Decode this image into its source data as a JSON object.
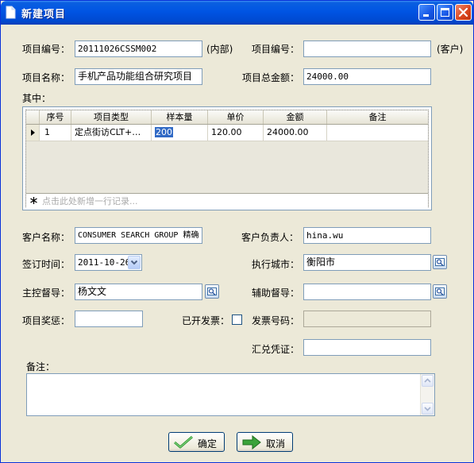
{
  "window": {
    "title": "新建项目"
  },
  "form": {
    "project_no_label": "项目编号：",
    "project_no_value": "20111026CSSM002",
    "internal_suffix": "(内部)",
    "client_project_no_label": "项目编号：",
    "client_project_no_value": "",
    "client_suffix": "(客户)",
    "project_name_label": "项目名称：",
    "project_name_value": "手机产品功能组合研究项目",
    "total_amount_label": "项目总金额：",
    "total_amount_value": "24000.00",
    "of_which_label": "其中：",
    "customer_name_label": "客户名称：",
    "customer_name_value": "CONSUMER SEARCH GROUP  精确",
    "customer_contact_label": "客户负责人：",
    "customer_contact_value": "hina.wu",
    "sign_date_label": "签订时间：",
    "sign_date_value": "2011-10-26",
    "exec_city_label": "执行城市：",
    "exec_city_value": "衡阳市",
    "main_supervisor_label": "主控督导：",
    "main_supervisor_value": "杨文文",
    "assist_supervisor_label": "辅助督导：",
    "assist_supervisor_value": "",
    "bonus_label": "项目奖惩：",
    "bonus_value": "",
    "invoiced_label": "已开发票：",
    "invoice_no_label": "发票号码：",
    "invoice_no_value": "",
    "voucher_label": "汇兑凭证：",
    "voucher_value": "",
    "remarks_label": "备注：",
    "remarks_value": ""
  },
  "grid": {
    "headers": [
      "序号",
      "项目类型",
      "样本量",
      "单价",
      "金额",
      "备注"
    ],
    "rows": [
      {
        "no": "1",
        "type": "定点街访CLT+…",
        "sample": "200",
        "price": "120.00",
        "amount": "24000.00",
        "note": ""
      }
    ],
    "new_row_placeholder": "点击此处新增一行记录..."
  },
  "buttons": {
    "ok": "确定",
    "cancel": "取消"
  },
  "colors": {
    "titlebar": "#0054e3",
    "dialog_bg": "#ece9d8",
    "field_border": "#7f9db9"
  }
}
